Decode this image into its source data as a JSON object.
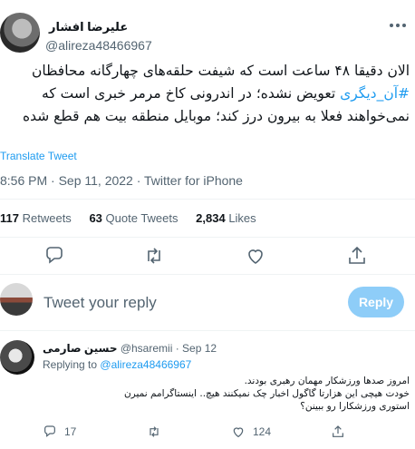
{
  "tweet": {
    "author_name": "علیرضا افشار",
    "author_handle": "@alireza48466967",
    "text_before": "الان دقیقا ۴۸ ساعت است که شیفت حلقه‌های چهارگانه محافظان ",
    "hashtag": "#آن_دیگری",
    "text_after": " تعویض نشده؛ در اندرونی کاخ مرمر خبری است که نمی‌خواهند فعلا به بیرون درز کند؛ موبایل منطقه بیت هم قطع شده",
    "translate_label": "Translate Tweet",
    "timestamp": "8:56 PM · Sep 11, 2022 · Twitter for iPhone"
  },
  "stats": {
    "retweets_count": "117",
    "retweets_label": "Retweets",
    "quotes_count": "63",
    "quotes_label": "Quote Tweets",
    "likes_count": "2,834",
    "likes_label": "Likes"
  },
  "actions": [
    "reply-icon",
    "retweet-icon",
    "like-icon",
    "share-icon"
  ],
  "composer": {
    "placeholder": "Tweet your reply",
    "button_label": "Reply"
  },
  "reply": {
    "author_name": "حسین صارمی",
    "author_handle": "@hsaremii",
    "date": "· Sep 12",
    "replying_prefix": "Replying to",
    "replying_handle": "@alireza48466967",
    "line1": "امروز صدها ورزشکار مهمان رهبری بودند.",
    "line2": "خودت هیچی این هزارتا گاگول اخبار چک نمیکنند هیچ.. اینستاگرامم نمیرن",
    "line3": "استوری ورزشکارا رو ببینن؟",
    "reply_count": "17",
    "retweet_count": "",
    "like_count": "124"
  },
  "colors": {
    "accent": "#1d9bf0",
    "muted": "#536471",
    "reply_button_disabled": "#8ecdf8"
  }
}
